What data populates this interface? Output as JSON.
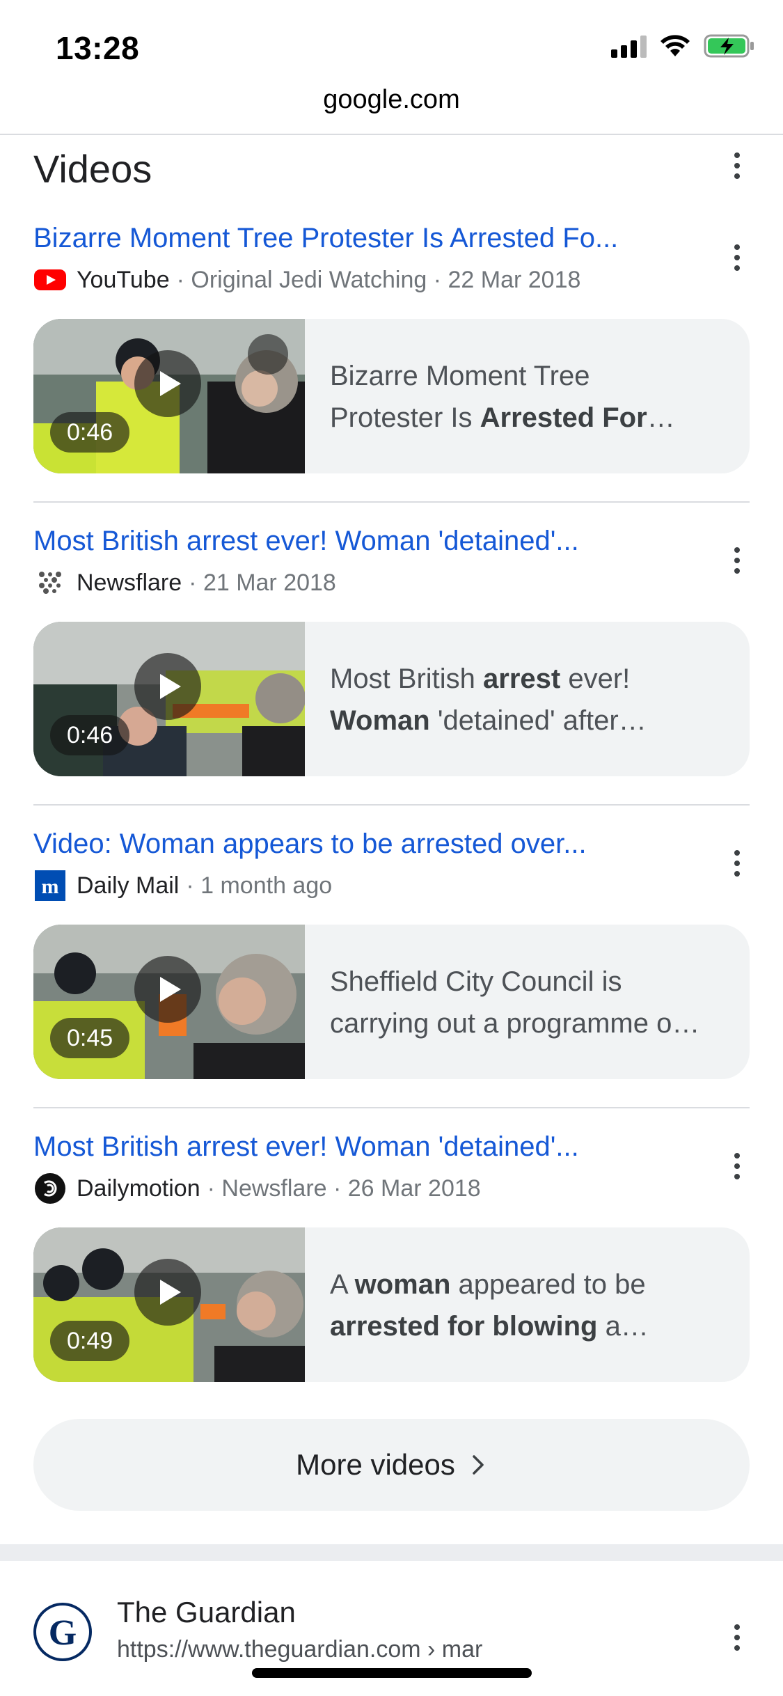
{
  "status_bar": {
    "time": "13:28"
  },
  "browser": {
    "url": "google.com"
  },
  "section": {
    "title": "Videos"
  },
  "results": [
    {
      "title": "Bizarre Moment Tree Protester Is Arrested Fo...",
      "source": "YouTube",
      "meta": "· Original Jedi Watching · 22 Mar 2018",
      "duration": "0:46",
      "snippet_line1": [
        {
          "t": "Bizarre Moment Tree",
          "b": false
        }
      ],
      "snippet_line2": [
        {
          "t": "Protester Is ",
          "b": false
        },
        {
          "t": "Arrested For",
          "b": true
        },
        {
          "t": "…",
          "b": false
        }
      ]
    },
    {
      "title": "Most British arrest ever! Woman 'detained'...",
      "source": "Newsflare",
      "meta": "· 21 Mar 2018",
      "duration": "0:46",
      "snippet_line1": [
        {
          "t": "Most British ",
          "b": false
        },
        {
          "t": "arrest",
          "b": true
        },
        {
          "t": " ever!",
          "b": false
        }
      ],
      "snippet_line2": [
        {
          "t": "Woman",
          "b": true
        },
        {
          "t": " 'detained' after…",
          "b": false
        }
      ]
    },
    {
      "title": "Video: Woman appears to be arrested over...",
      "source": "Daily Mail",
      "meta": "· 1 month ago",
      "duration": "0:45",
      "snippet_line1": [
        {
          "t": "Sheffield City Council is",
          "b": false
        }
      ],
      "snippet_line2": [
        {
          "t": "carrying out a programme o…",
          "b": false
        }
      ]
    },
    {
      "title": "Most British arrest ever! Woman 'detained'...",
      "source": "Dailymotion",
      "meta": "· Newsflare · 26 Mar 2018",
      "duration": "0:49",
      "snippet_line1": [
        {
          "t": "A ",
          "b": false
        },
        {
          "t": "woman",
          "b": true
        },
        {
          "t": " appeared to be",
          "b": false
        }
      ],
      "snippet_line2": [
        {
          "t": "arrested for blowing",
          "b": true
        },
        {
          "t": " a…",
          "b": false
        }
      ]
    }
  ],
  "more_videos": {
    "label": "More videos"
  },
  "next_result": {
    "name": "The Guardian",
    "url": "https://www.theguardian.com › mar"
  },
  "colors": {
    "link": "#1558d6",
    "youtube_red": "#ff0000",
    "dailymail_blue": "#004db3",
    "guardian_navy": "#052962",
    "card_bg": "#f1f3f4"
  }
}
